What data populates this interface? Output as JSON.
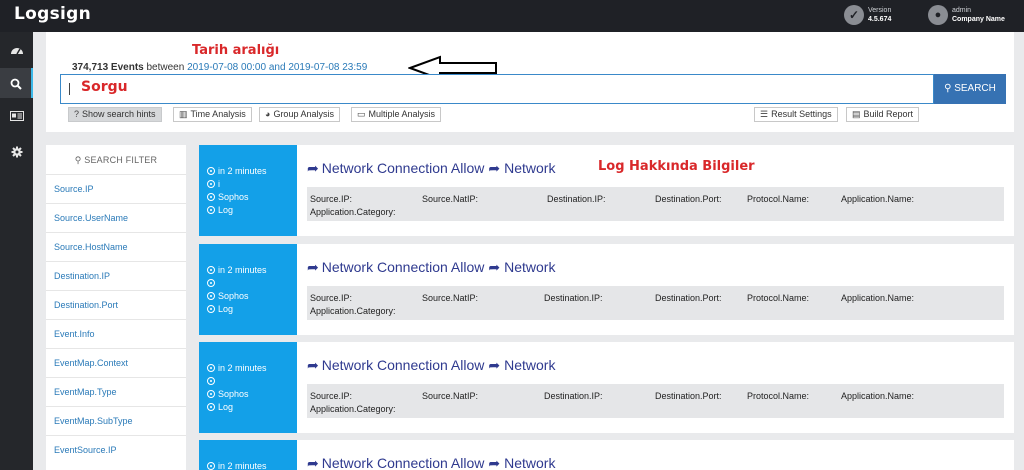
{
  "header": {
    "logo": "Logsign",
    "version_label": "Version",
    "version_value": "4.5.674",
    "user_name": "admin",
    "company": "Company Name"
  },
  "sidebar": {
    "items": [
      {
        "icon": "dashboard-icon"
      },
      {
        "icon": "search-icon"
      },
      {
        "icon": "id-card-icon"
      },
      {
        "icon": "gear-icon"
      }
    ]
  },
  "search": {
    "count": "374,713 Events",
    "between": "between",
    "from": "2019-07-08 00:00",
    "and": "and",
    "to": "2019-07-08 23:59",
    "button": "SEARCH",
    "annotation_range": "Tarih aralığı",
    "annotation_query": "Sorgu"
  },
  "tools": {
    "hints": "Show search hints",
    "time": "Time Analysis",
    "group": "Group Analysis",
    "multiple": "Multiple Analysis",
    "result_settings": "Result Settings",
    "build_report": "Build Report"
  },
  "filter": {
    "title": "SEARCH FILTER",
    "items": [
      "Source.IP",
      "Source.UserName",
      "Source.HostName",
      "Destination.IP",
      "Destination.Port",
      "Event.Info",
      "EventMap.Context",
      "EventMap.Type",
      "EventMap.SubType",
      "EventSource.IP"
    ]
  },
  "annotation_log": "Log Hakkında Bilgiler",
  "cards": [
    {
      "time": "in 2 minutes",
      "line2": "i",
      "vendor": "Sophos",
      "kind": "Log",
      "title_a": "Network Connection Allow",
      "title_b": "Network",
      "f1": "Source.IP:",
      "f2": "Source.NatIP:",
      "f3": "Destination.IP:",
      "f4": "Destination.Port:",
      "f5": "Protocol.Name:",
      "f6": "Application.Name:",
      "f7": "Application.Category:"
    },
    {
      "time": "in 2 minutes",
      "line2": "",
      "vendor": "Sophos",
      "kind": "Log",
      "title_a": "Network Connection Allow",
      "title_b": "Network",
      "f1": "Source.IP:",
      "f2": "Source.NatIP:",
      "f3": "Destination.IP:",
      "f4": "Destination.Port:",
      "f5": "Protocol.Name:",
      "f6": "Application.Name:",
      "f7": "Application.Category:"
    },
    {
      "time": "in 2 minutes",
      "line2": "",
      "vendor": "Sophos",
      "kind": "Log",
      "title_a": "Network Connection Allow",
      "title_b": "Network",
      "f1": "Source.IP:",
      "f2": "Source.NatIP:",
      "f3": "Destination.IP:",
      "f4": "Destination.Port:",
      "f5": "Protocol.Name:",
      "f6": "Application.Name:",
      "f7": "Application.Category:"
    },
    {
      "time": "in 2 minutes",
      "title_a": "Network Connection Allow",
      "title_b": "Network"
    }
  ],
  "colors": {
    "accent": "#13a0e8",
    "search_button": "#3672b3",
    "annotation": "#d9282a",
    "title": "#2f3a8f"
  }
}
